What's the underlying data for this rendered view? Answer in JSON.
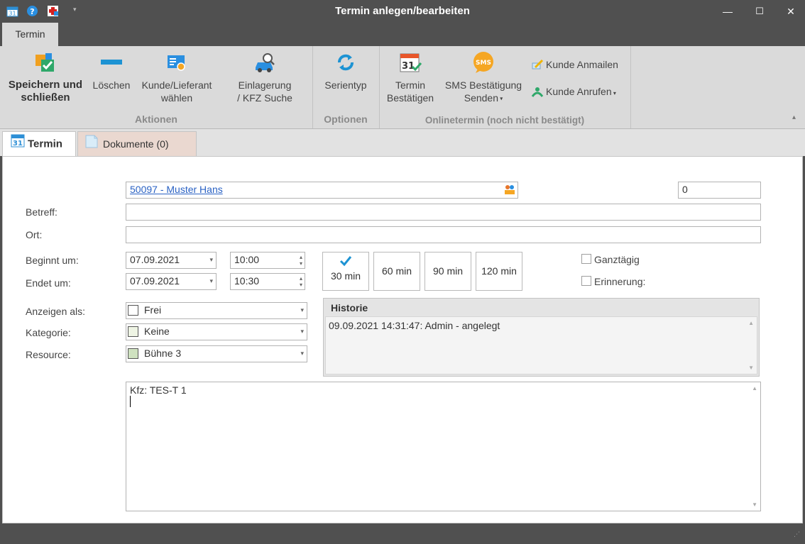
{
  "window": {
    "title": "Termin anlegen/bearbeiten",
    "minimize_glyph": "—",
    "maximize_glyph": "☐",
    "close_glyph": "✕",
    "quick_access": [
      "calendar-31-icon",
      "help-icon",
      "swiss-flag-icon",
      "dropdown-arrow-icon"
    ]
  },
  "ribbon": {
    "tab_label": "Termin",
    "groups": {
      "aktionen": "Aktionen",
      "optionen": "Optionen",
      "onlinetermin": "Onlinetermin (noch nicht bestätigt)"
    },
    "buttons": {
      "save_close": [
        "Speichern und",
        "schließen"
      ],
      "delete": "Löschen",
      "customer_supplier": [
        "Kunde/Lieferant",
        "wählen"
      ],
      "storage_search": [
        "Einlagerung",
        "/ KFZ Suche"
      ],
      "series": "Serientyp",
      "confirm": [
        "Termin",
        "Bestätigen"
      ],
      "sms": [
        "SMS Bestätigung",
        "Senden"
      ],
      "sms_icon_text": "SMS",
      "mail_customer": "Kunde Anmailen",
      "call_customer": "Kunde Anrufen"
    }
  },
  "doc_tabs": {
    "termin": "Termin",
    "dokumente": "Dokumente (0)",
    "calendar_day": "31"
  },
  "form": {
    "customer_link": "50097 - Muster Hans",
    "number_field": "0",
    "labels": {
      "betreff": "Betreff:",
      "ort": "Ort:",
      "beginnt": "Beginnt um:",
      "endet": "Endet um:",
      "anzeigen": "Anzeigen als:",
      "kategorie": "Kategorie:",
      "resource": "Resource:"
    },
    "betreff_value": "",
    "ort_value": "",
    "start_date": "07.09.2021",
    "start_time": "10:00",
    "end_date": "07.09.2021",
    "end_time": "10:30",
    "durations": [
      "30 min",
      "60 min",
      "90 min",
      "120 min"
    ],
    "selected_duration": "30 min",
    "ganztaegig": "Ganztägig",
    "erinnerung": "Erinnerung:",
    "anzeigen_value": "Frei",
    "kategorie_value": "Keine",
    "resource_value": "Bühne 3",
    "swatch_colors": {
      "frei": "#ffffff",
      "keine": "#eef4e4",
      "buehne": "#cfe2c0"
    },
    "historie_title": "Historie",
    "historie_entries": [
      "09.09.2021 14:31:47: Admin - angelegt"
    ],
    "notes_text": "Kfz: TES-T 1"
  },
  "colors": {
    "titlebar": "#505050",
    "ribbon": "#dadada",
    "link": "#2a62c4",
    "accent_blue": "#1d93d3"
  }
}
